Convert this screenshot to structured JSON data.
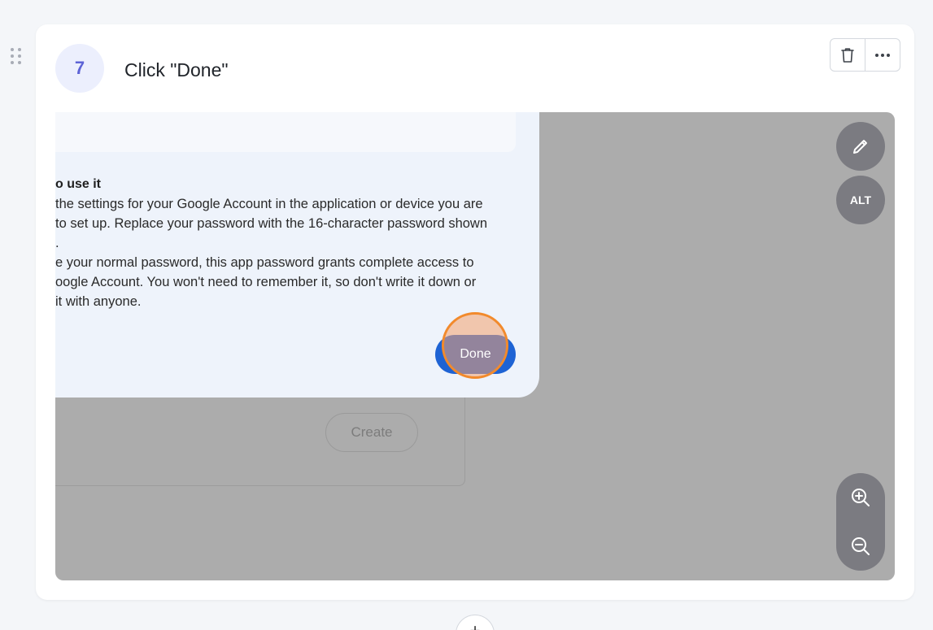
{
  "step": {
    "number": "7",
    "title": "Click \"Done\""
  },
  "actions": {
    "delete_icon": "trash-icon",
    "more_icon": "more-horizontal-icon"
  },
  "screenshot": {
    "dialog": {
      "heading": "o use it",
      "lines": [
        "the settings for your Google Account in the application or device you are",
        "to set up. Replace your password with the 16-character password shown",
        ".",
        "e your normal password, this app password grants complete access to",
        "oogle Account. You won't need to remember it, so don't write it down or",
        "it with anyone."
      ],
      "done_label": "Done"
    },
    "create_label": "Create"
  },
  "tools": {
    "edit_icon": "pencil-icon",
    "alt_label": "ALT",
    "zoom_in_icon": "zoom-in-icon",
    "zoom_out_icon": "zoom-out-icon"
  },
  "add_step_label": "+",
  "colors": {
    "accent": "#5d63d6",
    "badge_bg": "#eceffd",
    "done_button": "#1e63d4",
    "click_marker": "#f28a2c",
    "overlay_gray": "#acacac",
    "tool_button": "#7b7b81"
  }
}
